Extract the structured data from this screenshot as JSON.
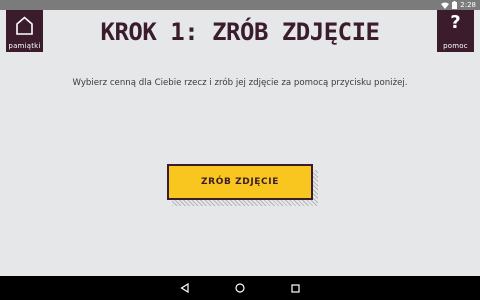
{
  "status_bar": {
    "time": "2:28",
    "icons": [
      "wifi-icon",
      "battery-icon"
    ]
  },
  "header": {
    "title": "KROK 1: ZRÓB ZDJĘCIE",
    "home_button": {
      "label": "pamiątki",
      "icon": "home-icon"
    },
    "help_button": {
      "label": "pomoc",
      "icon_text": "?"
    }
  },
  "main": {
    "instruction": "Wybierz cenną dla Ciebie rzecz i zrób jej zdjęcie za pomocą przycisku poniżej.",
    "photo_button": {
      "label": "ZRÓB ZDJĘCIE"
    }
  },
  "nav_bar": {
    "buttons": [
      "back-icon",
      "home-circle-icon",
      "recents-icon"
    ]
  },
  "colors": {
    "accent_dark": "#3a1c2d",
    "button_yellow": "#f8c61f",
    "background": "#e6e7e9",
    "status_bar": "#7b7b7b"
  }
}
